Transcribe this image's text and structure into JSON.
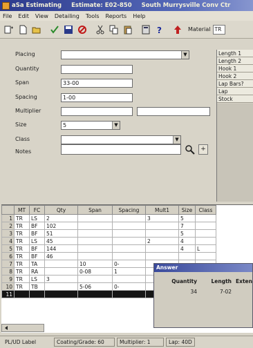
{
  "window": {
    "app": "aSa Estimating",
    "estimate": "Estimate: E02-850",
    "project": "South Murrysville Conv Ctr"
  },
  "menu": [
    "File",
    "Edit",
    "View",
    "Detailing",
    "Tools",
    "Reports",
    "Help"
  ],
  "toolbar": {
    "material_label": "Material",
    "material_value": "TR"
  },
  "form": {
    "placing_label": "Placing",
    "placing_value": "",
    "quantity_label": "Quantity",
    "quantity_value": "",
    "span_label": "Span",
    "span_value": "33-00",
    "spacing_label": "Spacing",
    "spacing_value": "1-00",
    "multiplier_label": "Multiplier",
    "multiplier_value": "",
    "size_label": "Size",
    "size_value": "5",
    "class_label": "Class",
    "class_value": "",
    "notes_label": "Notes",
    "notes_value": "",
    "notes_add": "+"
  },
  "right_list": [
    "Length 1",
    "Length 2",
    "Hook 1",
    "Hook 2",
    "Lap Bars?",
    "Lap",
    "Stock"
  ],
  "grid": {
    "headers": [
      "MT",
      "FC",
      "Qty",
      "Span",
      "Spacing",
      "Mult1",
      "Size",
      "Class"
    ],
    "rows": [
      {
        "n": "1",
        "mt": "TR",
        "fc": "LS",
        "qty": "2",
        "span": "",
        "spacing": "",
        "mult": "3",
        "size": "5",
        "cls": ""
      },
      {
        "n": "2",
        "mt": "TR",
        "fc": "BF",
        "qty": "102",
        "span": "",
        "spacing": "",
        "mult": "",
        "size": "7",
        "cls": ""
      },
      {
        "n": "3",
        "mt": "TR",
        "fc": "BF",
        "qty": "51",
        "span": "",
        "spacing": "",
        "mult": "",
        "size": "5",
        "cls": ""
      },
      {
        "n": "4",
        "mt": "TR",
        "fc": "LS",
        "qty": "45",
        "span": "",
        "spacing": "",
        "mult": "2",
        "size": "4",
        "cls": ""
      },
      {
        "n": "5",
        "mt": "TR",
        "fc": "BF",
        "qty": "144",
        "span": "",
        "spacing": "",
        "mult": "",
        "size": "4",
        "cls": "L"
      },
      {
        "n": "6",
        "mt": "TR",
        "fc": "BF",
        "qty": "46",
        "span": "",
        "spacing": "",
        "mult": "",
        "size": "",
        "cls": ""
      },
      {
        "n": "7",
        "mt": "TR",
        "fc": "TA",
        "qty": "",
        "span": "10",
        "spacing": "0-",
        "mult": "",
        "size": "",
        "cls": ""
      },
      {
        "n": "8",
        "mt": "TR",
        "fc": "RA",
        "qty": "",
        "span": "0-08",
        "spacing": "1",
        "mult": "",
        "size": "",
        "cls": ""
      },
      {
        "n": "9",
        "mt": "TR",
        "fc": "LS",
        "qty": "3",
        "span": "",
        "spacing": "",
        "mult": "",
        "size": "",
        "cls": ""
      },
      {
        "n": "10",
        "mt": "TR",
        "fc": "TB",
        "qty": "",
        "span": "5-06",
        "spacing": "0-",
        "mult": "",
        "size": "",
        "cls": ""
      },
      {
        "n": "11",
        "mt": "",
        "fc": "",
        "qty": "",
        "span": "",
        "spacing": "",
        "mult": "",
        "size": "",
        "cls": ""
      }
    ]
  },
  "answer": {
    "title": "Answer",
    "col_quantity": "Quantity",
    "col_length": "Length",
    "col_extension": "Exten",
    "quantity": "34",
    "length": "7-02",
    "extension": ""
  },
  "status": {
    "label": "PL/UD Label",
    "coating": "Coating/Grade: 60",
    "multiplier": "Multiplier: 1",
    "lap": "Lap: 40D"
  }
}
